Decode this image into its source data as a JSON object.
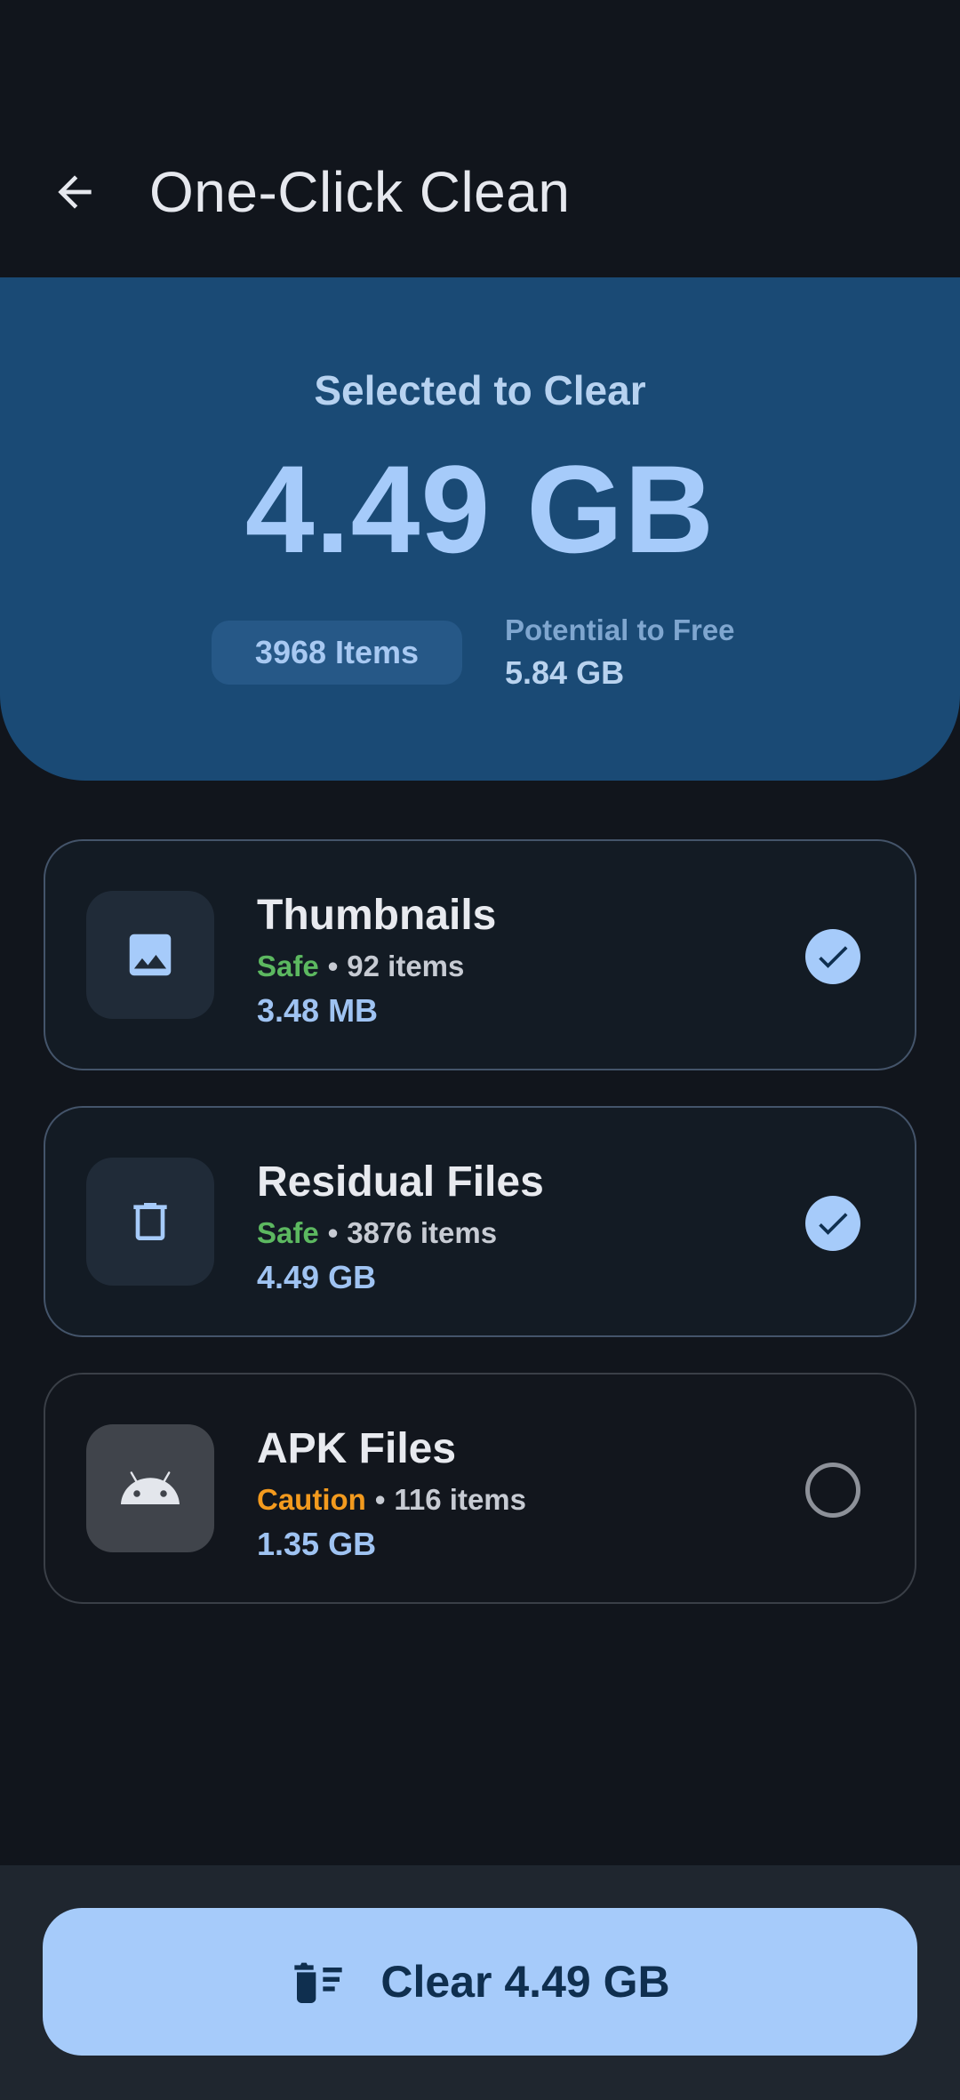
{
  "header": {
    "title": "One-Click Clean",
    "back_icon": "arrow-back-icon"
  },
  "summary": {
    "label": "Selected to Clear",
    "size": "4.49 GB",
    "items_chip": "3968 Items",
    "potential_label": "Potential to Free",
    "potential_value": "5.84 GB"
  },
  "categories": [
    {
      "title": "Thumbnails",
      "status": "Safe",
      "count": "92 items",
      "size": "3.48 MB",
      "icon": "image-icon",
      "selected": true
    },
    {
      "title": "Residual Files",
      "status": "Safe",
      "count": "3876 items",
      "size": "4.49 GB",
      "icon": "trash-icon",
      "selected": true
    },
    {
      "title": "APK Files",
      "status": "Caution",
      "count": "116 items",
      "size": "1.35 GB",
      "icon": "android-icon",
      "selected": false
    }
  ],
  "bottom": {
    "clear_label": "Clear 4.49 GB",
    "clear_icon": "delete-sweep-icon"
  },
  "colors": {
    "safe": "#5cb860",
    "caution": "#f39a1e",
    "accent": "#a6cbfa",
    "summary_bg": "#1a4a75"
  }
}
